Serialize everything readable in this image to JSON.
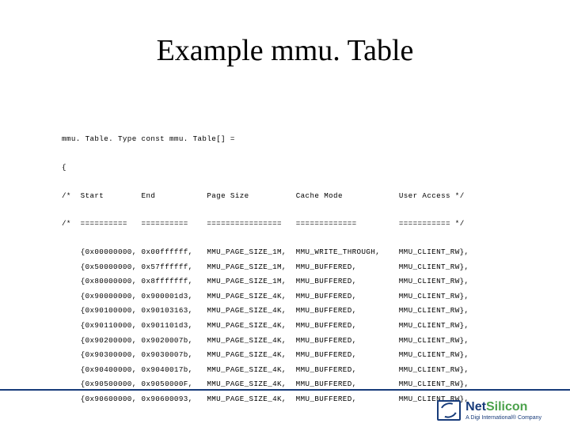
{
  "title": "Example mmu. Table",
  "code": {
    "declaration": "mmu. Table. Type const mmu. Table[] =",
    "open_brace": "{",
    "header_cols": {
      "start": "Start",
      "end": "End",
      "pagesize": "Page Size",
      "cachemode": "Cache Mode",
      "access": "User Access */"
    },
    "divider_cols": {
      "start": "==========",
      "end": "==========",
      "pagesize": "================",
      "cachemode": "=============",
      "access": "=========== */"
    },
    "rows": [
      {
        "start": "{0x00000000,",
        "end": "0x00ffffff,",
        "pagesize": "MMU_PAGE_SIZE_1M,",
        "cachemode": "MMU_WRITE_THROUGH,",
        "access": "MMU_CLIENT_RW},"
      },
      {
        "start": "{0x50000000,",
        "end": "0x57ffffff,",
        "pagesize": "MMU_PAGE_SIZE_1M,",
        "cachemode": "MMU_BUFFERED,",
        "access": "MMU_CLIENT_RW},"
      },
      {
        "start": "{0x80000000,",
        "end": "0x8fffffff,",
        "pagesize": "MMU_PAGE_SIZE_1M,",
        "cachemode": "MMU_BUFFERED,",
        "access": "MMU_CLIENT_RW},"
      },
      {
        "start": "{0x90000000,",
        "end": "0x900001d3,",
        "pagesize": "MMU_PAGE_SIZE_4K,",
        "cachemode": "MMU_BUFFERED,",
        "access": "MMU_CLIENT_RW},"
      },
      {
        "start": "{0x90100000,",
        "end": "0x90103163,",
        "pagesize": "MMU_PAGE_SIZE_4K,",
        "cachemode": "MMU_BUFFERED,",
        "access": "MMU_CLIENT_RW},"
      },
      {
        "start": "{0x90110000,",
        "end": "0x901101d3,",
        "pagesize": "MMU_PAGE_SIZE_4K,",
        "cachemode": "MMU_BUFFERED,",
        "access": "MMU_CLIENT_RW},"
      },
      {
        "start": "{0x90200000,",
        "end": "0x9020007b,",
        "pagesize": "MMU_PAGE_SIZE_4K,",
        "cachemode": "MMU_BUFFERED,",
        "access": "MMU_CLIENT_RW},"
      },
      {
        "start": "{0x90300000,",
        "end": "0x9030007b,",
        "pagesize": "MMU_PAGE_SIZE_4K,",
        "cachemode": "MMU_BUFFERED,",
        "access": "MMU_CLIENT_RW},"
      },
      {
        "start": "{0x90400000,",
        "end": "0x9040017b,",
        "pagesize": "MMU_PAGE_SIZE_4K,",
        "cachemode": "MMU_BUFFERED,",
        "access": "MMU_CLIENT_RW},"
      },
      {
        "start": "{0x90500000,",
        "end": "0x9050000F,",
        "pagesize": "MMU_PAGE_SIZE_4K,",
        "cachemode": "MMU_BUFFERED,",
        "access": "MMU_CLIENT_RW},"
      },
      {
        "start": "{0x90600000,",
        "end": "0x90600093,",
        "pagesize": "MMU_PAGE_SIZE_4K,",
        "cachemode": "MMU_BUFFERED,",
        "access": "MMU_CLIENT_RW},"
      }
    ]
  },
  "logo": {
    "name_a": "Net",
    "name_b": "Silicon",
    "tagline": "A Digi International® Company"
  }
}
